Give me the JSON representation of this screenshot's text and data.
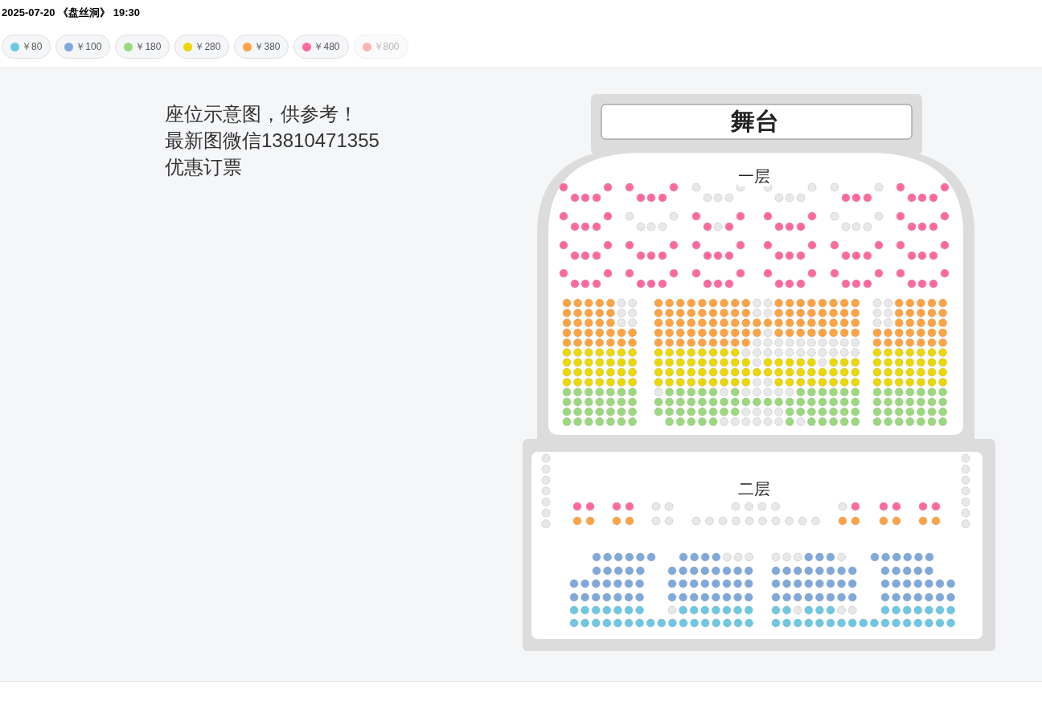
{
  "header": {
    "title": "2025-07-20 《盘丝洞》 19:30"
  },
  "prices": [
    {
      "label": "￥80",
      "color": "#6cc8e3",
      "disabled": false
    },
    {
      "label": "￥100",
      "color": "#7fa9dd",
      "disabled": false
    },
    {
      "label": "￥180",
      "color": "#9ad97c",
      "disabled": false
    },
    {
      "label": "￥280",
      "color": "#ecd800",
      "disabled": false
    },
    {
      "label": "￥380",
      "color": "#ffa343",
      "disabled": false
    },
    {
      "label": "￥480",
      "color": "#ff69a0",
      "disabled": false
    },
    {
      "label": "￥800",
      "color": "#ffb3b3",
      "disabled": true
    }
  ],
  "notice": [
    "座位示意图，供参考！",
    "最新图微信13810471355",
    "优惠订票"
  ],
  "stage": {
    "label": "舞台"
  },
  "floors": [
    {
      "label": "一层"
    },
    {
      "label": "二层"
    }
  ]
}
